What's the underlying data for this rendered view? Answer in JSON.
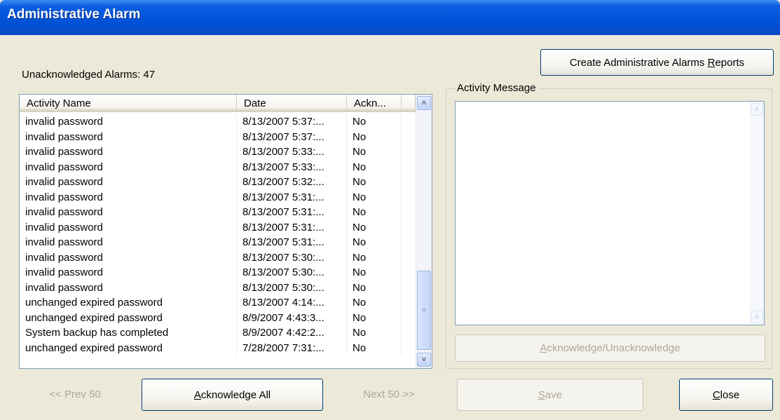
{
  "window": {
    "title": "Administrative Alarm"
  },
  "summary": {
    "unacknowledged_label": "Unacknowledged Alarms: 47"
  },
  "reports_button": {
    "pre": "Create Administrative Alarms ",
    "accel": "R",
    "post": "eports"
  },
  "table": {
    "columns": [
      "Activity Name",
      "Date",
      "Ackn..."
    ],
    "rows": [
      [
        "invalid password",
        "8/13/2007 5:37:...",
        "No"
      ],
      [
        "invalid password",
        "8/13/2007 5:37:...",
        "No"
      ],
      [
        "invalid password",
        "8/13/2007 5:33:...",
        "No"
      ],
      [
        "invalid password",
        "8/13/2007 5:33:...",
        "No"
      ],
      [
        "invalid password",
        "8/13/2007 5:32:...",
        "No"
      ],
      [
        "invalid password",
        "8/13/2007 5:31:...",
        "No"
      ],
      [
        "invalid password",
        "8/13/2007 5:31:...",
        "No"
      ],
      [
        "invalid password",
        "8/13/2007 5:31:...",
        "No"
      ],
      [
        "invalid password",
        "8/13/2007 5:31:...",
        "No"
      ],
      [
        "invalid password",
        "8/13/2007 5:30:...",
        "No"
      ],
      [
        "invalid password",
        "8/13/2007 5:30:...",
        "No"
      ],
      [
        "invalid password",
        "8/13/2007 5:30:...",
        "No"
      ],
      [
        "unchanged expired password",
        "8/13/2007 4:14:...",
        "No"
      ],
      [
        "unchanged expired password",
        "8/9/2007 4:43:3...",
        "No"
      ],
      [
        "System backup has completed",
        "8/9/2007 4:42:2...",
        "No"
      ],
      [
        "unchanged expired password",
        "7/28/2007 7:31:...",
        "No"
      ]
    ]
  },
  "activity_message": {
    "legend": "Activity Message",
    "value": ""
  },
  "ack_toggle_button": {
    "accel": "A",
    "rest": "cknowledge/Unacknowledge"
  },
  "prev_button": {
    "label": "<< Prev 50"
  },
  "ack_all_button": {
    "accel": "A",
    "rest": "cknowledge All"
  },
  "next_button": {
    "label": "Next 50 >>"
  },
  "save_button": {
    "accel": "S",
    "rest": "ave"
  },
  "close_button": {
    "accel": "C",
    "rest": "lose"
  }
}
